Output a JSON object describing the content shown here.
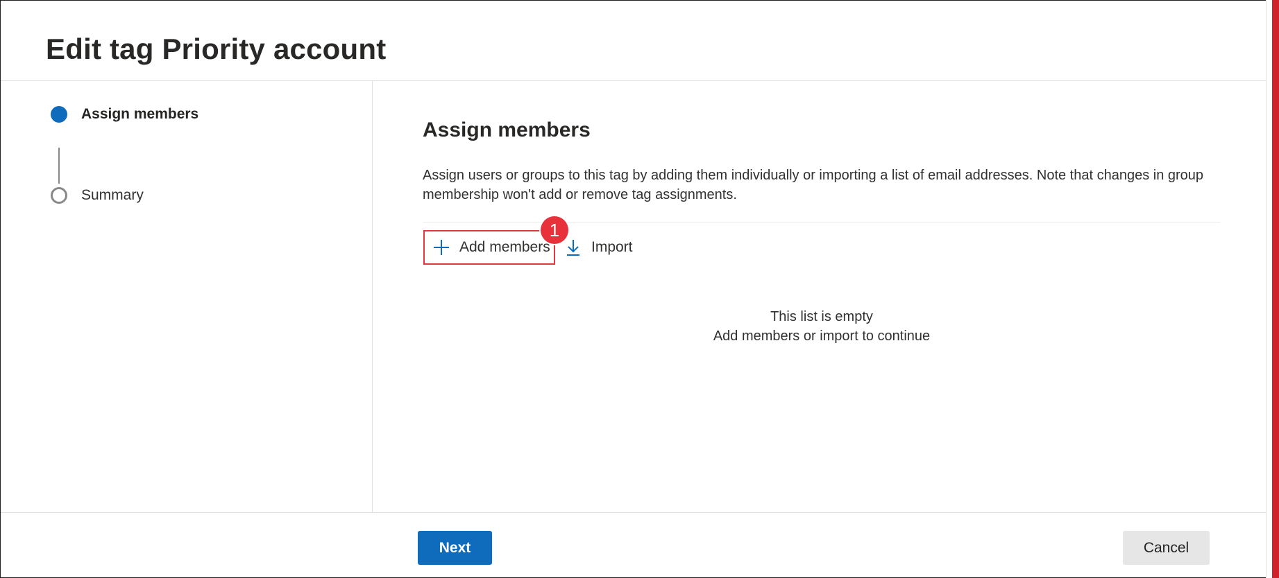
{
  "header": {
    "title": "Edit tag Priority account"
  },
  "steps": [
    {
      "label": "Assign members",
      "state": "active"
    },
    {
      "label": "Summary",
      "state": "inactive"
    }
  ],
  "main": {
    "section_title": "Assign members",
    "description": "Assign users or groups to this tag by adding them individually or importing a list of email addresses. Note that changes in group membership won't add or remove tag assignments.",
    "toolbar": {
      "add_label": "Add members",
      "add_icon": "plus-icon",
      "import_label": "Import",
      "import_icon": "download-icon",
      "callout_number": "1"
    },
    "empty_state": {
      "line1": "This list is empty",
      "line2": "Add members or import to continue"
    }
  },
  "footer": {
    "next_label": "Next",
    "cancel_label": "Cancel"
  },
  "colors": {
    "accent": "#0f6cbd",
    "highlight": "#e0383e",
    "callout": "#e8323b"
  }
}
